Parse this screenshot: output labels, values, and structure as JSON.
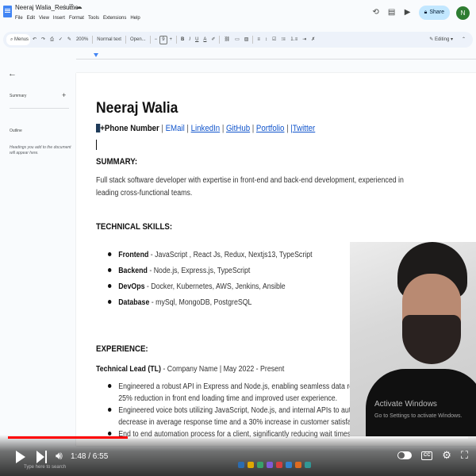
{
  "app": {
    "doc_title": "Neeraj Walia_Resume",
    "menu": [
      "File",
      "Edit",
      "View",
      "Insert",
      "Format",
      "Tools",
      "Extensions",
      "Help"
    ],
    "share_label": "Share",
    "avatar_initial": "N"
  },
  "toolbar": {
    "search_label": "Menus",
    "zoom": "200%",
    "style": "Normal text",
    "font": "Open...",
    "font_size": "9",
    "bold": "B",
    "italic": "I",
    "underline": "U",
    "text_color": "A",
    "mode": "Editing"
  },
  "sidebar": {
    "summary_label": "Summary",
    "outline_label": "Outline",
    "outline_note": "Headings you add to the document will appear here."
  },
  "document": {
    "name": "Neeraj Walia",
    "contact": {
      "phone": "+Phone Number",
      "email": "EMail",
      "linkedin": "LinkedIn",
      "github": "GitHub",
      "portfolio": "Portfolio",
      "twitter_prefix": "|",
      "twitter": "Twitter"
    },
    "summary_heading": "SUMMARY:",
    "summary_text": "Full stack software developer with expertise in front-end and back-end development, experienced in leading cross-functional teams.",
    "skills_heading": "TECHNICAL SKILLS:",
    "skills": [
      {
        "label": "Frontend",
        "value": " - JavaScript , React Js, Redux, Nextjs13, TypeScript"
      },
      {
        "label": "Backend",
        "value": " - Node.js, Express.js, TypeScript"
      },
      {
        "label": "DevOps",
        "value": " - Docker, Kubernetes, AWS, Jenkins, Ansible"
      },
      {
        "label": "Database",
        "value": " - mySql, MongoDB, PostgreSQL"
      }
    ],
    "experience_heading": "EXPERIENCE:",
    "job_title": "Technical Lead (TL)",
    "job_company": " - Company Name",
    "job_sep": "|",
    "job_dates": "May 2022 - Present",
    "experience_lines": [
      "Engineered a robust API in Express and Node.js, enabling seamless data retrieval fr",
      "25% reduction in front end loading time and improved user experience.",
      "Engineered voice bots utilizing JavaScript, Node.js, and internal APIs to automate cu",
      "decrease in average response time and a 30% increase in customer satisfaction sco",
      "End to end automation process for a client, significantly reducing wait times from 2"
    ]
  },
  "overlay": {
    "activate_title": "Activate Windows",
    "activate_sub": "Go to Settings to activate Windows."
  },
  "player": {
    "time": "1:48 / 6:55",
    "progress_fraction": 0.26,
    "cc_label": "CC",
    "taskbar_search": "Type here to search"
  }
}
